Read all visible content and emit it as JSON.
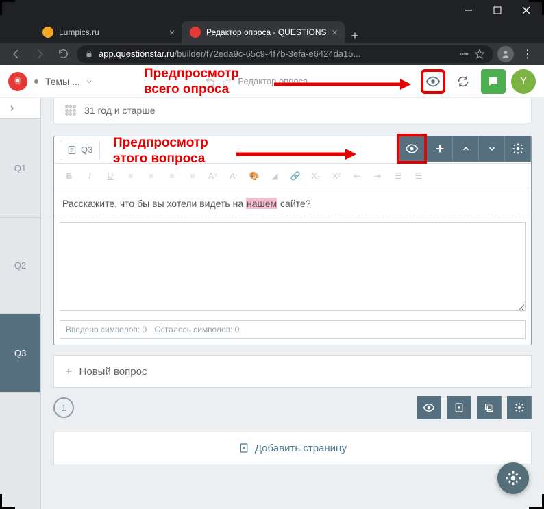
{
  "browser": {
    "tabs": [
      {
        "label": "Lumpics.ru",
        "favicon": "#f5a623"
      },
      {
        "label": "Редактор опроса - QUESTIONS",
        "favicon": "#e53935"
      }
    ],
    "url_host": "app.questionstar.ru",
    "url_path": "/builder/f72eda9c-65c9-4f7b-3efa-e6424da15..."
  },
  "header": {
    "themes_label": "Темы ...",
    "center_label": "Редактор опроса",
    "avatar_letter": "Y"
  },
  "sidebar": {
    "items": [
      {
        "label": "Q1"
      },
      {
        "label": "Q2"
      },
      {
        "label": "Q3"
      }
    ]
  },
  "answer_row": {
    "label": "31 год и старше"
  },
  "question": {
    "type_label": "Q3",
    "prompt_pre": "Расскажите, что бы вы хотели видеть на ",
    "prompt_hl": "нашем",
    "prompt_post": " сайте?",
    "chars_entered_label": "Введено символов: 0",
    "chars_left_label": "Осталось символов: 0"
  },
  "new_question_label": "Новый вопрос",
  "page_number": "1",
  "add_page_label": "Добавить страницу",
  "annotations": {
    "global_preview": "Предпросмотр\nвсего опроса",
    "question_preview": "Предпросмотр\nэтого вопроса"
  }
}
